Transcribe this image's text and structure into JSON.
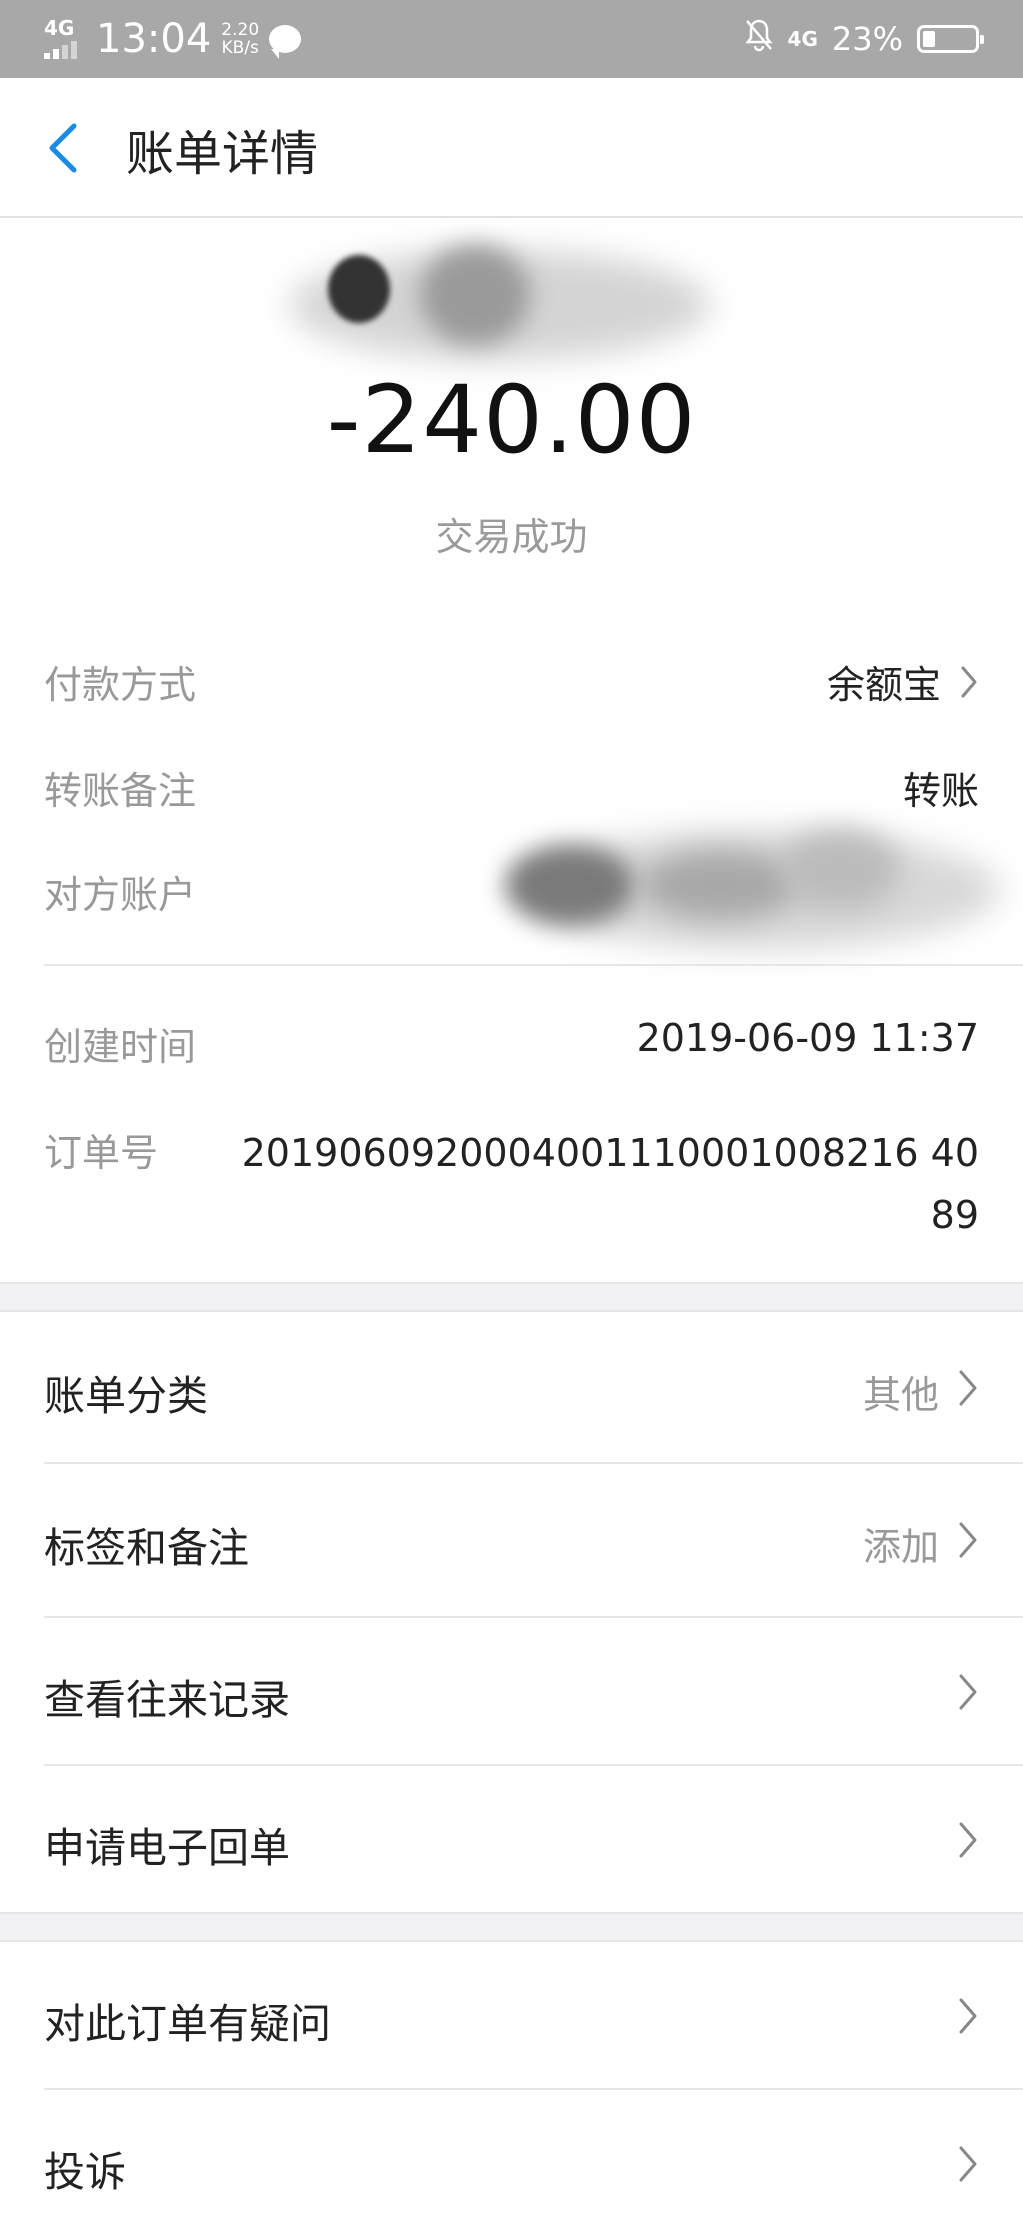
{
  "status_bar": {
    "network_left": "4G",
    "time": "13:04",
    "speed_value": "2.20",
    "speed_unit": "KB/s",
    "network_right": "4G",
    "battery_percent": "23%",
    "battery_level": 0.23,
    "icons": [
      "signal-icon",
      "message-icon",
      "mute-bell-icon",
      "battery-icon"
    ]
  },
  "nav": {
    "back_icon": "chevron-left-icon",
    "title": "账单详情",
    "accent_color": "#1a8ae6"
  },
  "summary": {
    "amount": "-240.00",
    "status": "交易成功"
  },
  "details": {
    "payment_method": {
      "label": "付款方式",
      "value": "余额宝"
    },
    "transfer_note": {
      "label": "转账备注",
      "value": "转账"
    },
    "counterparty": {
      "label": "对方账户"
    },
    "created_time": {
      "label": "创建时间",
      "value": "2019-06-09 11:37"
    },
    "order_no": {
      "label": "订单号",
      "value": "2019060920004001110001008216 4089"
    }
  },
  "menu_group_1": [
    {
      "label": "账单分类",
      "value": "其他"
    },
    {
      "label": "标签和备注",
      "value": "添加"
    },
    {
      "label": "查看往来记录",
      "value": ""
    },
    {
      "label": "申请电子回单",
      "value": ""
    }
  ],
  "menu_group_2": [
    {
      "label": "对此订单有疑问",
      "value": ""
    },
    {
      "label": "投诉",
      "value": ""
    }
  ]
}
